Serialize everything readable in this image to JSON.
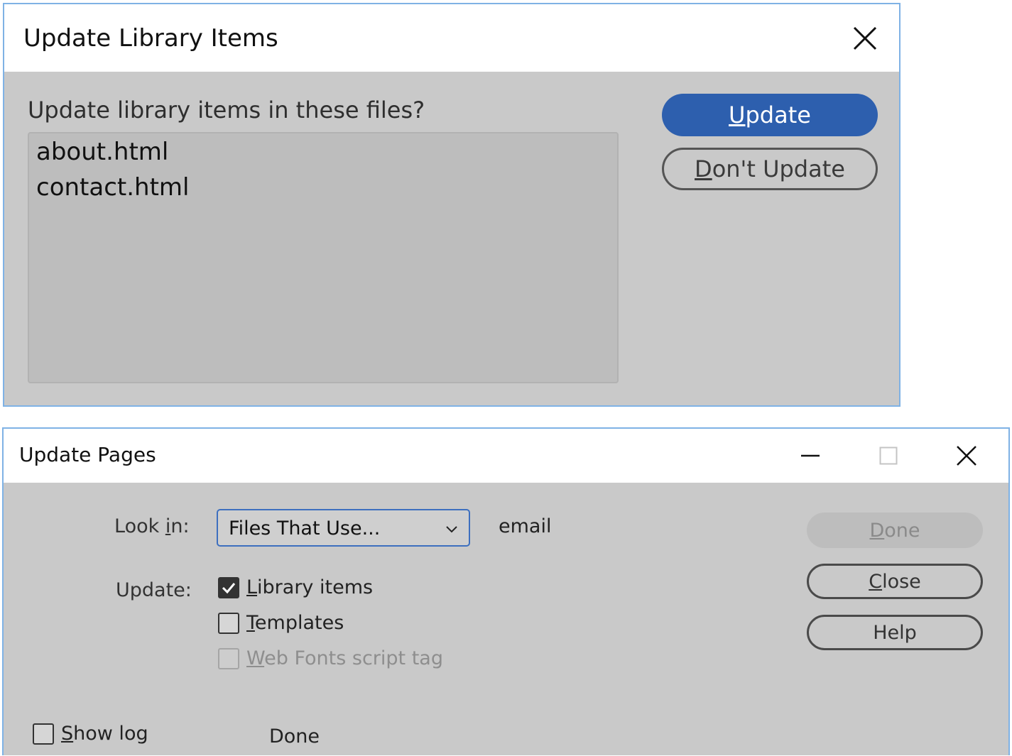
{
  "update_library_dialog": {
    "title": "Update Library Items",
    "prompt": "Update library items in these files?",
    "files": [
      "about.html",
      "contact.html"
    ],
    "buttons": {
      "update": {
        "mnemonic": "U",
        "rest": "pdate"
      },
      "dont_update": {
        "mnemonic": "D",
        "rest": "on't Update"
      }
    },
    "accent_color": "#2d5fae"
  },
  "update_pages_dialog": {
    "title": "Update Pages",
    "look_in": {
      "label_pre": "Look ",
      "label_mnemonic": "i",
      "label_post": "n:",
      "selected": "Files That Use...",
      "value_text": "email"
    },
    "update_label": "Update:",
    "options": [
      {
        "mnemonic": "L",
        "rest": "ibrary items",
        "checked": true,
        "enabled": true
      },
      {
        "mnemonic": "T",
        "rest": "emplates",
        "checked": false,
        "enabled": true
      },
      {
        "mnemonic": "W",
        "rest": "eb Fonts script tag",
        "checked": false,
        "enabled": false
      }
    ],
    "show_log": {
      "mnemonic": "S",
      "rest": "how log",
      "checked": false
    },
    "status_text": "Done",
    "buttons": {
      "done": {
        "mnemonic": "D",
        "rest": "one",
        "enabled": false
      },
      "close": {
        "mnemonic": "C",
        "rest": "lose"
      },
      "help": "Help"
    }
  },
  "icons": {
    "close": "close-icon",
    "minimize": "minimize-icon",
    "maximize": "maximize-icon",
    "checkmark": "checkmark-icon",
    "dropdown": "chevron-down-icon"
  }
}
